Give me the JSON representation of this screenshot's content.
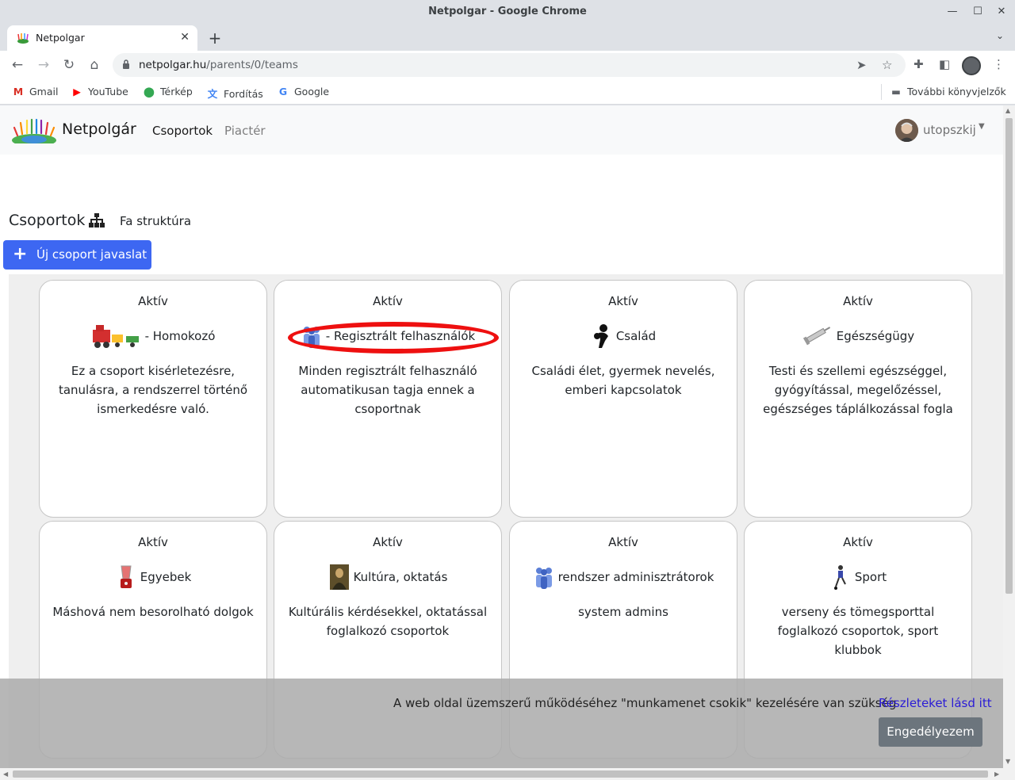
{
  "window": {
    "title": "Netpolgar - Google Chrome"
  },
  "tab": {
    "title": "Netpolgar"
  },
  "omnibox": {
    "host": "netpolgar.hu",
    "path": "/parents/0/teams"
  },
  "bookmarks": [
    {
      "label": "Gmail",
      "icon": "gmail-icon",
      "glyph": "M",
      "color": "#d93025"
    },
    {
      "label": "YouTube",
      "icon": "youtube-icon",
      "glyph": "▶",
      "color": "#ff0000"
    },
    {
      "label": "Térkép",
      "icon": "maps-icon",
      "glyph": "⬤",
      "color": "#34a853"
    },
    {
      "label": "Fordítás",
      "icon": "translate-icon",
      "glyph": "文",
      "color": "#4285f4"
    },
    {
      "label": "Google",
      "icon": "google-icon",
      "glyph": "G",
      "color": "#4285f4"
    }
  ],
  "other_bookmarks": "További könyvjelzők",
  "navbar": {
    "brand": "Netpolgár",
    "links": [
      {
        "label": "Csoportok",
        "active": true
      },
      {
        "label": "Piactér",
        "active": false
      }
    ],
    "user": "utopszkij"
  },
  "page": {
    "heading": "Csoportok",
    "tree_link": "Fa struktúra",
    "new_button": "Új csoport javaslat"
  },
  "cards": [
    {
      "status": "Aktív",
      "name": "- Homokozó",
      "icon": "toy-train-icon",
      "desc": "Ez a csoport kisérletezésre, tanulásra, a rendszerrel történő ismerkedésre való."
    },
    {
      "status": "Aktív",
      "name": "- Regisztrált felhasználók",
      "icon": "users-group-icon",
      "desc": "Minden regisztrált felhasználó automatikusan tagja ennek a csoportnak"
    },
    {
      "status": "Aktív",
      "name": "Család",
      "icon": "family-icon",
      "desc": "Családi élet, gyermek nevelés, emberi kapcsolatok"
    },
    {
      "status": "Aktív",
      "name": "Egészségügy",
      "icon": "syringe-icon",
      "desc": "Testi és szellemi egészséggel, gyógyítással, megelőzéssel, egészséges táplálkozással fogla"
    },
    {
      "status": "Aktív",
      "name": "Egyebek",
      "icon": "blender-icon",
      "desc": "Máshová nem besorolható dolgok"
    },
    {
      "status": "Aktív",
      "name": "Kultúra, oktatás",
      "icon": "mona-lisa-icon",
      "desc": "Kultúrális kérdésekkel, oktatással foglalkozó csoportok"
    },
    {
      "status": "Aktív",
      "name": "rendszer adminisztrátorok",
      "icon": "admins-group-icon",
      "desc": "system admins"
    },
    {
      "status": "Aktív",
      "name": "Sport",
      "icon": "football-player-icon",
      "desc": "verseny és tömegsporttal foglalkozó csoportok, sport klubbok"
    }
  ],
  "cookie": {
    "text": "A web oldal üzemszerű működéséhez \"munkamenet csokik\" kezelésére van szükség",
    "link": "Részleteket lásd itt",
    "button": "Engedélyezem"
  },
  "colors": {
    "primary_button": "#3d67f2",
    "highlight": "#ee1010",
    "cookie_link": "#2a1bd6"
  }
}
